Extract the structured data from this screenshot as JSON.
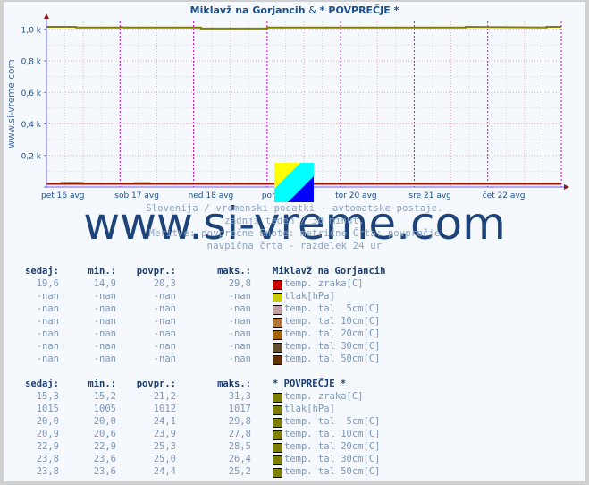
{
  "header": {
    "title_part1": "Miklavž na Gorjancih",
    "title_amp": "&",
    "title_part2": "* POVPREČJE *"
  },
  "side_label": "www.si-vreme.com",
  "watermark": "www.si-vreme.com",
  "captions": [
    "Slovenija / vremenski podatki - avtomatske postaje.",
    "zadnji teden / 30 minut.",
    "Meritve: povprečne  Enote: metrične  Črta: povprečje",
    "navpična črta - razdelek 24 ur"
  ],
  "chart_data": {
    "type": "line",
    "title": "Miklavž na Gorjancih & * POVPREČJE *",
    "xlabel": "",
    "ylabel": "",
    "ylim": [
      0,
      1050
    ],
    "yticks": [
      {
        "value": 200,
        "label": "0,2 k"
      },
      {
        "value": 400,
        "label": "0,4 k"
      },
      {
        "value": 600,
        "label": "0,6 k"
      },
      {
        "value": 800,
        "label": "0,8 k"
      },
      {
        "value": 1000,
        "label": "1,0 k"
      }
    ],
    "x_range_days": [
      0,
      7
    ],
    "xticks": [
      {
        "day": 0,
        "label": "pet 16 avg"
      },
      {
        "day": 1,
        "label": "sob 17 avg"
      },
      {
        "day": 2,
        "label": "ned 18 avg"
      },
      {
        "day": 3,
        "label": "pon 19 avg"
      },
      {
        "day": 4,
        "label": "tor 20 avg"
      },
      {
        "day": 5,
        "label": "sre 21 avg"
      },
      {
        "day": 6,
        "label": "čet 22 avg"
      }
    ],
    "grid": true,
    "series": [
      {
        "name": "tlak[hPa] (povprečje)",
        "color": "#808000",
        "x": [
          0,
          0.4,
          0.4,
          1.0,
          1.02,
          1.05,
          2.1,
          2.1,
          3.0,
          3.0,
          5.7,
          5.7,
          6.8,
          6.8,
          7.0
        ],
        "y": [
          1016,
          1016,
          1012,
          1012,
          1015,
          1012,
          1012,
          1005,
          1005,
          1012,
          1012,
          1016,
          1012,
          1016,
          1016
        ]
      },
      {
        "name": "temp. zraka[C] (povprečje)",
        "color": "#808000",
        "x": [
          0,
          0.2,
          0.2,
          0.5,
          0.5,
          1.2,
          1.2,
          1.4,
          1.4,
          7.0
        ],
        "y": [
          21,
          21,
          26,
          26,
          21,
          21,
          25,
          25,
          21,
          21
        ]
      },
      {
        "name": "temp. zraka[C] (Miklavž na Gorjancih)",
        "color": "#cc0000",
        "x": [
          0,
          7
        ],
        "y": [
          20,
          20
        ]
      }
    ],
    "legend": "below"
  },
  "tables": [
    {
      "station": "Miklavž na Gorjancih",
      "headers": [
        "sedaj:",
        "min.:",
        "povpr.:",
        "maks.:"
      ],
      "rows": [
        {
          "sedaj": "19,6",
          "min": "14,9",
          "povpr": "20,3",
          "maks": "29,8",
          "color": "#cc0000",
          "label": "temp. zraka[C]"
        },
        {
          "sedaj": "-nan",
          "min": "-nan",
          "povpr": "-nan",
          "maks": "-nan",
          "color": "#cccc00",
          "label": "tlak[hPa]"
        },
        {
          "sedaj": "-nan",
          "min": "-nan",
          "povpr": "-nan",
          "maks": "-nan",
          "color": "#c0a0a0",
          "label": "temp. tal  5cm[C]"
        },
        {
          "sedaj": "-nan",
          "min": "-nan",
          "povpr": "-nan",
          "maks": "-nan",
          "color": "#b07838",
          "label": "temp. tal 10cm[C]"
        },
        {
          "sedaj": "-nan",
          "min": "-nan",
          "povpr": "-nan",
          "maks": "-nan",
          "color": "#a06400",
          "label": "temp. tal 20cm[C]"
        },
        {
          "sedaj": "-nan",
          "min": "-nan",
          "povpr": "-nan",
          "maks": "-nan",
          "color": "#605030",
          "label": "temp. tal 30cm[C]"
        },
        {
          "sedaj": "-nan",
          "min": "-nan",
          "povpr": "-nan",
          "maks": "-nan",
          "color": "#603000",
          "label": "temp. tal 50cm[C]"
        }
      ]
    },
    {
      "station": "* POVPREČJE *",
      "headers": [
        "sedaj:",
        "min.:",
        "povpr.:",
        "maks.:"
      ],
      "rows": [
        {
          "sedaj": "15,3",
          "min": "15,2",
          "povpr": "21,2",
          "maks": "31,3",
          "color": "#808000",
          "label": "temp. zraka[C]"
        },
        {
          "sedaj": "1015",
          "min": "1005",
          "povpr": "1012",
          "maks": "1017",
          "color": "#808000",
          "label": "tlak[hPa]"
        },
        {
          "sedaj": "20,0",
          "min": "20,0",
          "povpr": "24,1",
          "maks": "29,8",
          "color": "#808000",
          "label": "temp. tal  5cm[C]"
        },
        {
          "sedaj": "20,9",
          "min": "20,6",
          "povpr": "23,9",
          "maks": "27,8",
          "color": "#808000",
          "label": "temp. tal 10cm[C]"
        },
        {
          "sedaj": "22,9",
          "min": "22,9",
          "povpr": "25,3",
          "maks": "28,5",
          "color": "#808000",
          "label": "temp. tal 20cm[C]"
        },
        {
          "sedaj": "23,8",
          "min": "23,6",
          "povpr": "25,0",
          "maks": "26,4",
          "color": "#808000",
          "label": "temp. tal 30cm[C]"
        },
        {
          "sedaj": "23,8",
          "min": "23,6",
          "povpr": "24,4",
          "maks": "25,2",
          "color": "#808000",
          "label": "temp. tal 50cm[C]"
        }
      ]
    }
  ]
}
